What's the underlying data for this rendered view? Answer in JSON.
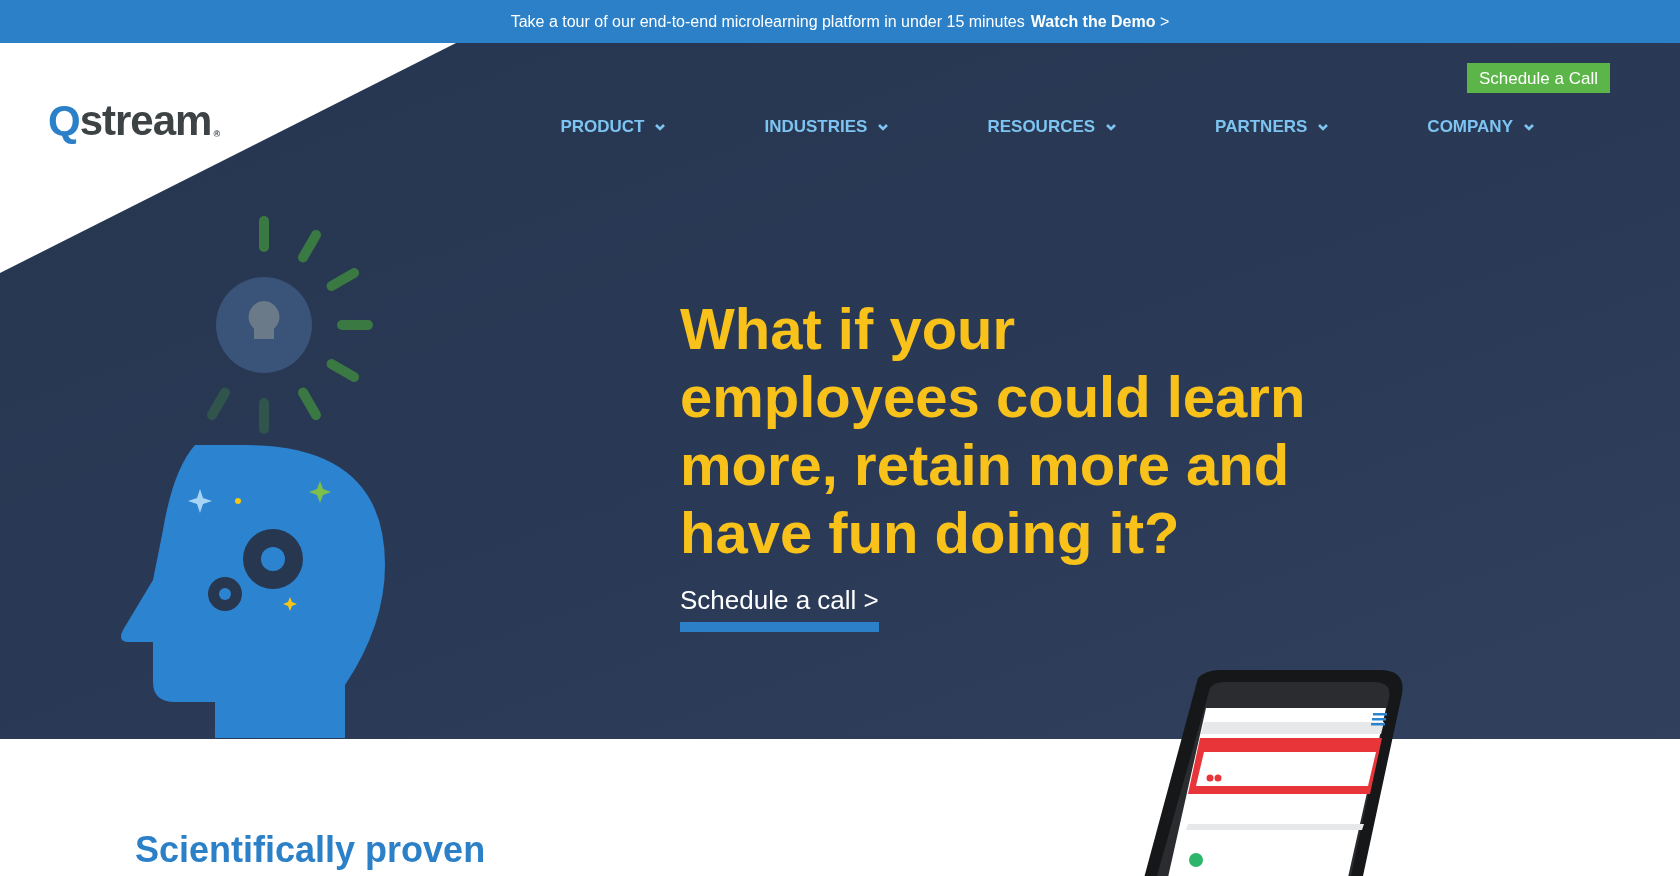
{
  "announcement": {
    "text": "Take a tour of our end-to-end microlearning platform in under 15 minutes",
    "link": "Watch the Demo",
    "arrow": ">"
  },
  "logo": {
    "text": "Qstream",
    "mark": "®"
  },
  "header": {
    "cta": "Schedule a Call"
  },
  "nav": [
    {
      "label": "PRODUCT"
    },
    {
      "label": "INDUSTRIES"
    },
    {
      "label": "RESOURCES"
    },
    {
      "label": "PARTNERS"
    },
    {
      "label": "COMPANY"
    }
  ],
  "hero": {
    "headline_lines": [
      "What if your",
      "employees could learn",
      "more, retain more and",
      "have fun doing it?"
    ],
    "link": "Schedule a call >",
    "phone": {
      "kind": "picture"
    }
  },
  "section": {
    "heading": "Scientifically proven"
  }
}
